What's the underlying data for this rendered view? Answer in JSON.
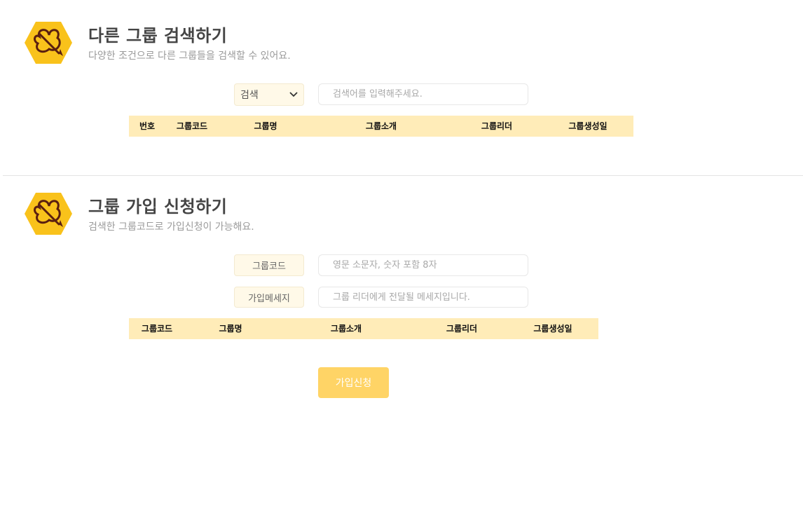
{
  "search_section": {
    "title": "다른 그룹 검색하기",
    "subtitle": "다양한 조건으로 다른 그룹들을 검색할 수 있어요.",
    "select_value": "검색",
    "search_placeholder": "검색어를 입력해주세요.",
    "table_headers": [
      "번호",
      "그룹코드",
      "그룹명",
      "그룹소개",
      "그룹리더",
      "그룹생성일"
    ]
  },
  "join_section": {
    "title": "그룹 가입 신청하기",
    "subtitle": "검색한 그룹코드로 가입신청이 가능해요.",
    "group_code_label": "그룹코드",
    "group_code_placeholder": "영문 소문자, 숫자 포함 8자",
    "message_label": "가입메세지",
    "message_placeholder": "그룹 리더에게 전달될 메세지입니다.",
    "table_headers": [
      "그룹코드",
      "그룹명",
      "그룹소개",
      "그룹리더",
      "그룹생성일"
    ],
    "submit_label": "가입신청"
  },
  "colors": {
    "brand_yellow": "#f9c21b",
    "table_header_bg": "#ffecb8",
    "button_bg": "#ffd466",
    "logo_stroke": "#5a1f10"
  },
  "icons": {
    "logo": "hexagon-pretzel-pencil-icon",
    "select_arrow": "chevron-down-icon"
  }
}
